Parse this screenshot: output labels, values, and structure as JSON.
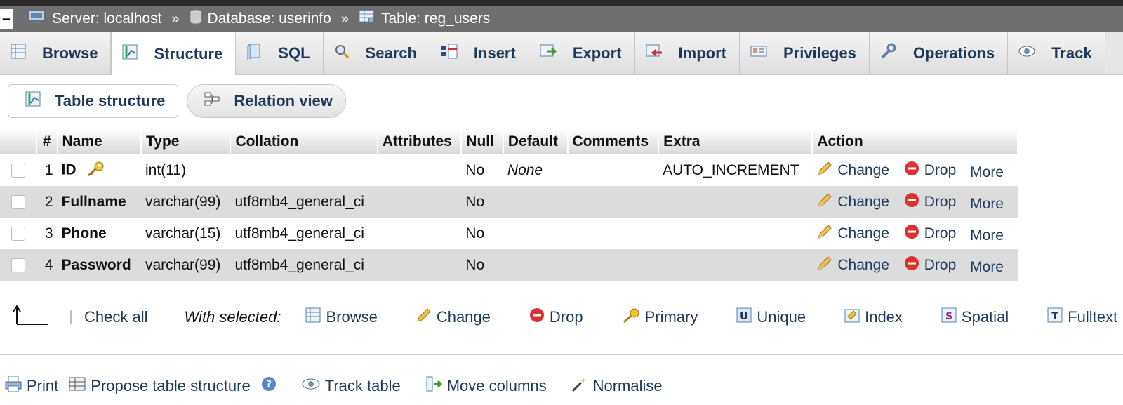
{
  "breadcrumb": {
    "collapse": "–",
    "server": "Server: localhost",
    "database": "Database: userinfo",
    "table": "Table: reg_users",
    "separator": "»"
  },
  "tabs": [
    {
      "label": "Browse",
      "icon": "browse-icon"
    },
    {
      "label": "Structure",
      "icon": "structure-icon",
      "active": true
    },
    {
      "label": "SQL",
      "icon": "sql-icon"
    },
    {
      "label": "Search",
      "icon": "search-icon"
    },
    {
      "label": "Insert",
      "icon": "insert-icon"
    },
    {
      "label": "Export",
      "icon": "export-icon"
    },
    {
      "label": "Import",
      "icon": "import-icon"
    },
    {
      "label": "Privileges",
      "icon": "privileges-icon"
    },
    {
      "label": "Operations",
      "icon": "operations-icon"
    },
    {
      "label": "Track",
      "icon": "tracking-icon"
    }
  ],
  "subtabs": {
    "table_structure": "Table structure",
    "relation_view": "Relation view"
  },
  "table": {
    "headers": [
      "#",
      "Name",
      "Type",
      "Collation",
      "Attributes",
      "Null",
      "Default",
      "Comments",
      "Extra",
      "Action"
    ],
    "rows": [
      {
        "num": "1",
        "name": "ID",
        "type": "int(11)",
        "collation": "",
        "attributes": "",
        "null": "No",
        "default": "None",
        "comments": "",
        "extra": "AUTO_INCREMENT",
        "primary": true
      },
      {
        "num": "2",
        "name": "Fullname",
        "type": "varchar(99)",
        "collation": "utf8mb4_general_ci",
        "attributes": "",
        "null": "No",
        "default": "",
        "comments": "",
        "extra": ""
      },
      {
        "num": "3",
        "name": "Phone",
        "type": "varchar(15)",
        "collation": "utf8mb4_general_ci",
        "attributes": "",
        "null": "No",
        "default": "",
        "comments": "",
        "extra": ""
      },
      {
        "num": "4",
        "name": "Password",
        "type": "varchar(99)",
        "collation": "utf8mb4_general_ci",
        "attributes": "",
        "null": "No",
        "default": "",
        "comments": "",
        "extra": ""
      }
    ],
    "actions": {
      "change": "Change",
      "drop": "Drop",
      "more": "More"
    }
  },
  "with_selected": {
    "check_all": "Check all",
    "label": "With selected:",
    "items": [
      "Browse",
      "Change",
      "Drop",
      "Primary",
      "Unique",
      "Index",
      "Spatial",
      "Fulltext"
    ]
  },
  "bottom_links": {
    "print": "Print",
    "propose": "Propose table structure",
    "track": "Track table",
    "move": "Move columns",
    "normalise": "Normalise"
  },
  "colors": {
    "link": "#1d3a5c",
    "crumb_bg": "#6f6f6f",
    "row_alt": "#dcdcdc",
    "drop_red": "#d9322f"
  }
}
